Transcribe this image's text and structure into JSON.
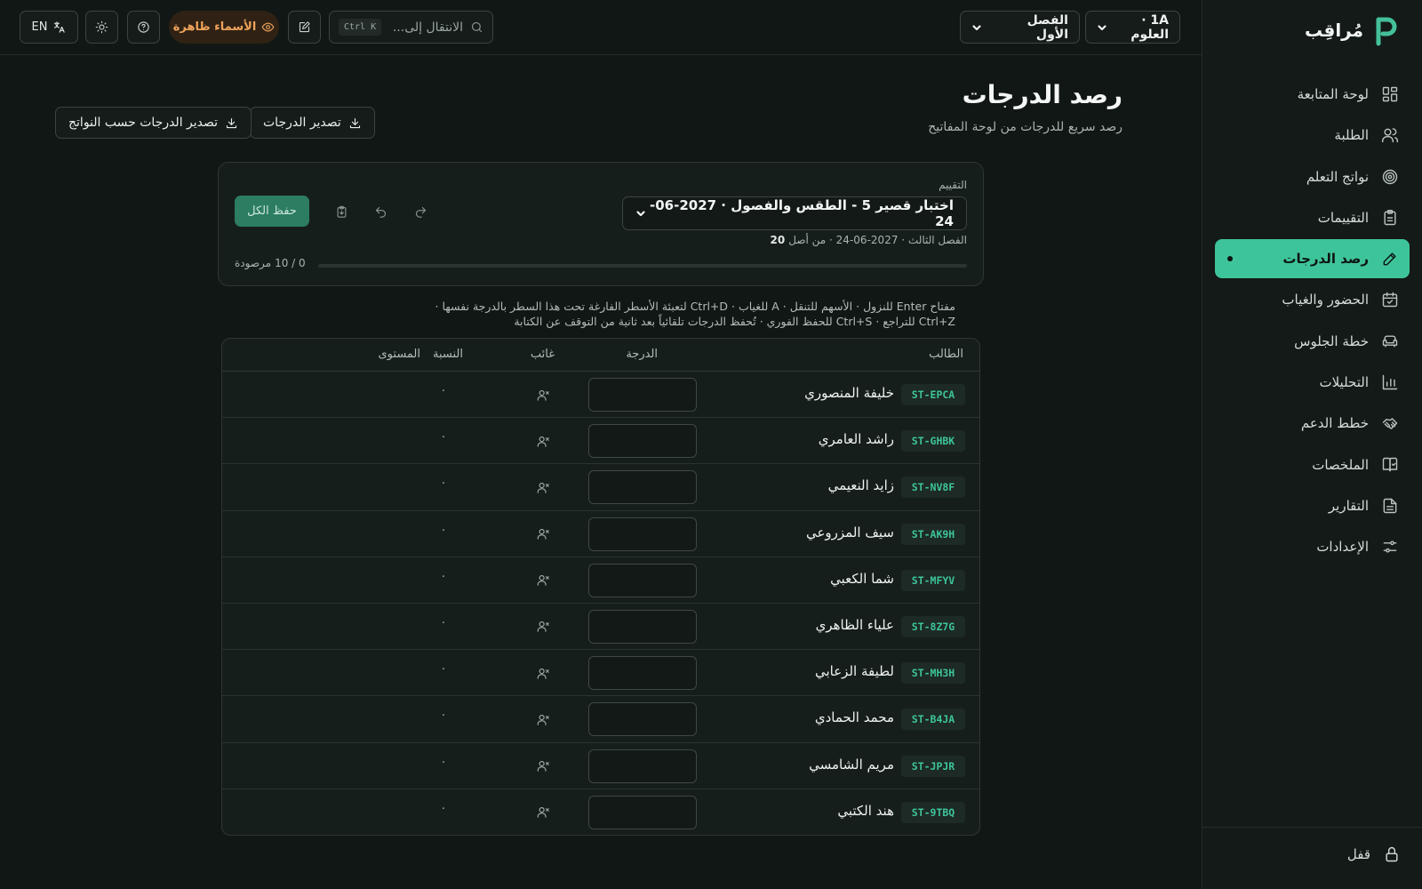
{
  "brand": {
    "name": "مُراقِب"
  },
  "nav": {
    "items": [
      {
        "label": "لوحة المتابعة",
        "icon": "dashboard-icon",
        "active": false
      },
      {
        "label": "الطلبة",
        "icon": "users-icon",
        "active": false
      },
      {
        "label": "نواتج التعلم",
        "icon": "target-icon",
        "active": false
      },
      {
        "label": "التقييمات",
        "icon": "clipboard-icon",
        "active": false
      },
      {
        "label": "رصد الدرجات",
        "icon": "pencil-icon",
        "active": true
      },
      {
        "label": "الحضور والغياب",
        "icon": "calendar-icon",
        "active": false
      },
      {
        "label": "خطة الجلوس",
        "icon": "seat-icon",
        "active": false
      },
      {
        "label": "التحليلات",
        "icon": "bar-chart-icon",
        "active": false
      },
      {
        "label": "خطط الدعم",
        "icon": "handshake-icon",
        "active": false
      },
      {
        "label": "الملخصات",
        "icon": "book-check-icon",
        "active": false
      },
      {
        "label": "التقارير",
        "icon": "file-text-icon",
        "active": false
      },
      {
        "label": "الإعدادات",
        "icon": "sliders-icon",
        "active": false
      }
    ],
    "lock_label": "قفل"
  },
  "topbar": {
    "class_select": "1A · العلوم",
    "term_select": "الفصل الأول",
    "search_placeholder": "الانتقال إلى...",
    "search_shortcut": "Ctrl K",
    "names_visible_label": "الأسماء ظاهرة",
    "lang_label": "EN"
  },
  "page": {
    "title": "رصد الدرجات",
    "subtitle": "رصد سريع للدرجات من لوحة المفاتيح",
    "export_grades": "تصدير الدرجات",
    "export_by_outcomes": "تصدير الدرجات حسب النواتج"
  },
  "assessment": {
    "label": "التقييم",
    "selected": "اختبار قصير 5 - الطقس والفصول · 2027-06-24",
    "meta_prefix": "الفصل الثالث · 2027-06-24 · من أصل",
    "max_score": "20",
    "save_all": "حفظ الكل",
    "progress_fraction": 0,
    "progress_count": "0 / 10",
    "progress_suffix": "مرصودة"
  },
  "hint": "مفتاح Enter للنزول · الأسهم للتنقل · A للغياب · Ctrl+D لتعبئة الأسطر الفارغة تحت هذا السطر بالدرجة نفسها · Ctrl+Z للتراجع · Ctrl+S للحفظ الفوري · تُحفظ الدرجات تلقائياً بعد ثانية من التوقف عن الكتابة",
  "table": {
    "headers": {
      "student": "الطالب",
      "grade": "الدرجة",
      "absent": "غائب",
      "percent": "النسبة",
      "level": "المستوى"
    },
    "rows": [
      {
        "id": "ST-EPCA",
        "name": "خليفة المنصوري",
        "grade": "",
        "percent": "·",
        "level": ""
      },
      {
        "id": "ST-GHBK",
        "name": "راشد العامري",
        "grade": "",
        "percent": "·",
        "level": ""
      },
      {
        "id": "ST-NV8F",
        "name": "زايد النعيمي",
        "grade": "",
        "percent": "·",
        "level": ""
      },
      {
        "id": "ST-AK9H",
        "name": "سيف المزروعي",
        "grade": "",
        "percent": "·",
        "level": ""
      },
      {
        "id": "ST-MFYV",
        "name": "شما الكعبي",
        "grade": "",
        "percent": "·",
        "level": ""
      },
      {
        "id": "ST-8Z7G",
        "name": "علياء الظاهري",
        "grade": "",
        "percent": "·",
        "level": ""
      },
      {
        "id": "ST-MH3H",
        "name": "لطيفة الزعابي",
        "grade": "",
        "percent": "·",
        "level": ""
      },
      {
        "id": "ST-B4JA",
        "name": "محمد الحمادي",
        "grade": "",
        "percent": "·",
        "level": ""
      },
      {
        "id": "ST-JPJR",
        "name": "مريم الشامسي",
        "grade": "",
        "percent": "·",
        "level": ""
      },
      {
        "id": "ST-9TBQ",
        "name": "هند الكتبي",
        "grade": "",
        "percent": "·",
        "level": ""
      }
    ]
  },
  "colors": {
    "accent": "#3ec49b",
    "background": "#111714",
    "warning": "#f0a35b"
  }
}
